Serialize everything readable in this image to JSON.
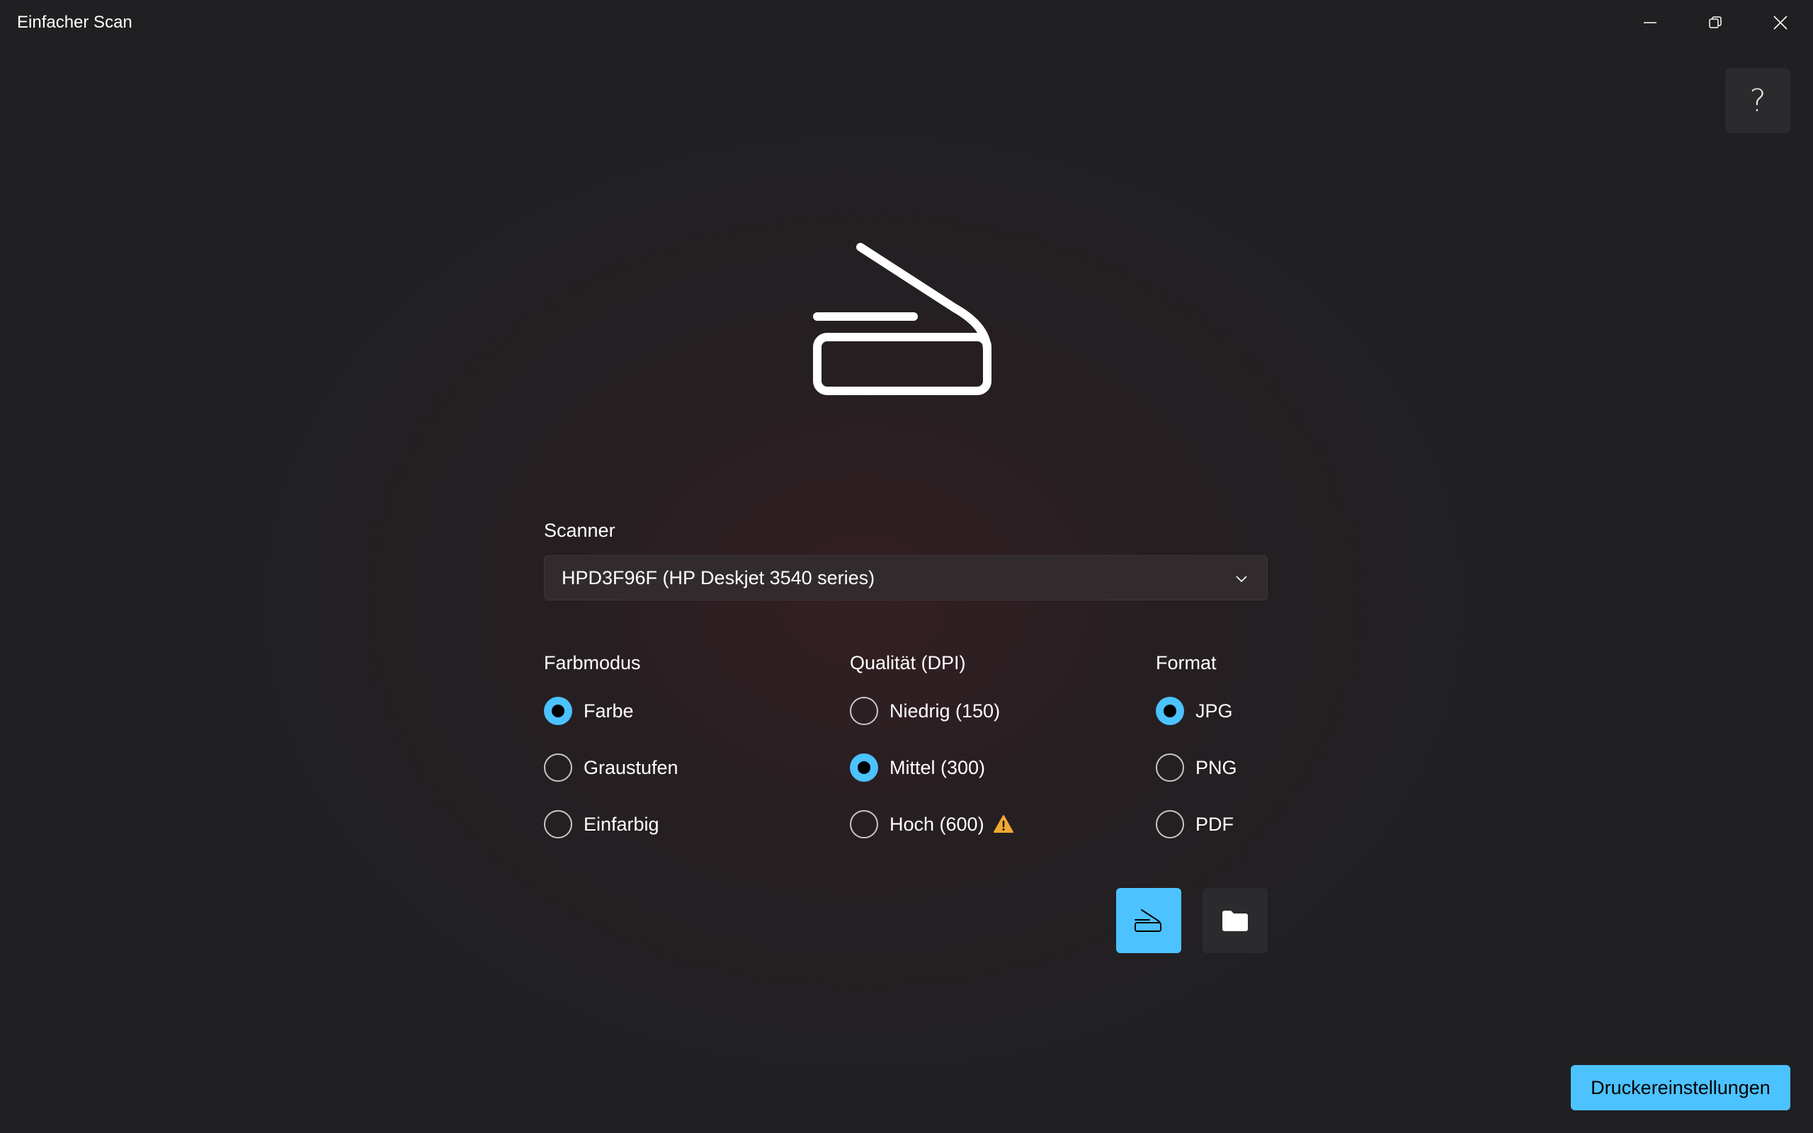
{
  "window": {
    "title": "Einfacher Scan",
    "controls": {
      "minimize_icon": "minimize-icon",
      "maximize_icon": "restore-icon",
      "close_icon": "close-icon"
    }
  },
  "help": {
    "label": "?"
  },
  "hero": {
    "icon": "scanner-icon"
  },
  "scanner": {
    "label": "Scanner",
    "selected": "HPD3F96F (HP Deskjet 3540 series)",
    "dropdown_icon": "chevron-down-icon"
  },
  "options": {
    "farbmodus": {
      "title": "Farbmodus",
      "items": [
        {
          "label": "Farbe",
          "checked": true
        },
        {
          "label": "Graustufen",
          "checked": false
        },
        {
          "label": "Einfarbig",
          "checked": false
        }
      ]
    },
    "qualitaet": {
      "title": "Qualität (DPI)",
      "items": [
        {
          "label": "Niedrig (150)",
          "checked": false
        },
        {
          "label": "Mittel (300)",
          "checked": true
        },
        {
          "label": "Hoch (600)",
          "checked": false,
          "icon": "warning-icon"
        }
      ]
    },
    "format": {
      "title": "Format",
      "items": [
        {
          "label": "JPG",
          "checked": true
        },
        {
          "label": "PNG",
          "checked": false
        },
        {
          "label": "PDF",
          "checked": false
        }
      ]
    }
  },
  "actions": {
    "scan_icon": "scanner-icon",
    "folder_icon": "folder-icon"
  },
  "footer": {
    "printer_settings_label": "Druckereinstellungen"
  },
  "colors": {
    "accent": "#4cc2ff",
    "background": "#202022",
    "warning": "#f0a830"
  }
}
